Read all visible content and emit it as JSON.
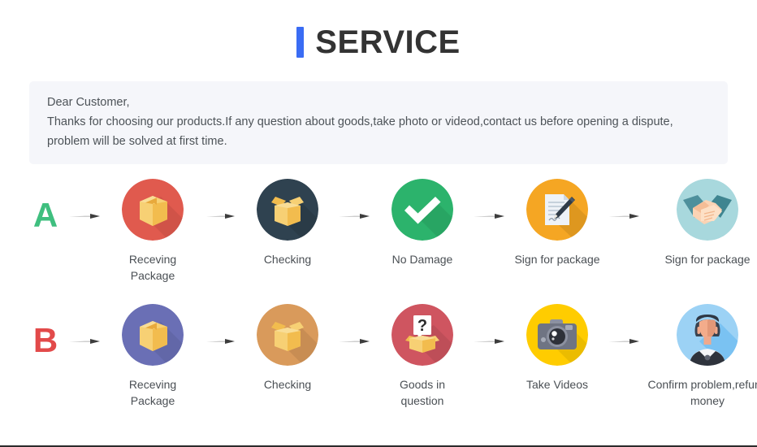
{
  "header": {
    "title": "SERVICE",
    "accent_color": "#3a6cf4"
  },
  "notice": {
    "line1": "Dear Customer,",
    "line2": "Thanks for choosing our products.If any question about goods,take photo or videod,contact us before opening a dispute,",
    "line3": "problem will be solved at first time.",
    "background_color": "#f5f6fa"
  },
  "arrow_icon": "arrow-right-icon",
  "flows": [
    {
      "letter": "A",
      "letter_color": "#3fbf7f",
      "steps": [
        {
          "icon": "closed-box-icon",
          "circle_color": "#e05a4e",
          "label": "Receving Package"
        },
        {
          "icon": "open-box-icon",
          "circle_color": "#2f4250",
          "label": "Checking"
        },
        {
          "icon": "checkmark-icon",
          "circle_color": "#2cb36c",
          "label": "No Damage"
        },
        {
          "icon": "sign-document-icon",
          "circle_color": "#f5a623",
          "label": "Sign for package"
        },
        {
          "icon": "handshake-icon",
          "circle_color": "#a8d8dd",
          "label": "Sign for package"
        }
      ]
    },
    {
      "letter": "B",
      "letter_color": "#e24a4a",
      "steps": [
        {
          "icon": "closed-box-icon",
          "circle_color": "#6a6fb5",
          "label": "Receving Package"
        },
        {
          "icon": "open-box-icon",
          "circle_color": "#d99a5b",
          "label": "Checking"
        },
        {
          "icon": "question-box-icon",
          "circle_color": "#cf5560",
          "label": "Goods in question"
        },
        {
          "icon": "camera-icon",
          "circle_color": "#ffcc00",
          "label": "Take Videos"
        },
        {
          "icon": "person-icon",
          "circle_color": "#9cd2f5",
          "label": "Confirm problem,refund money"
        }
      ]
    }
  ]
}
